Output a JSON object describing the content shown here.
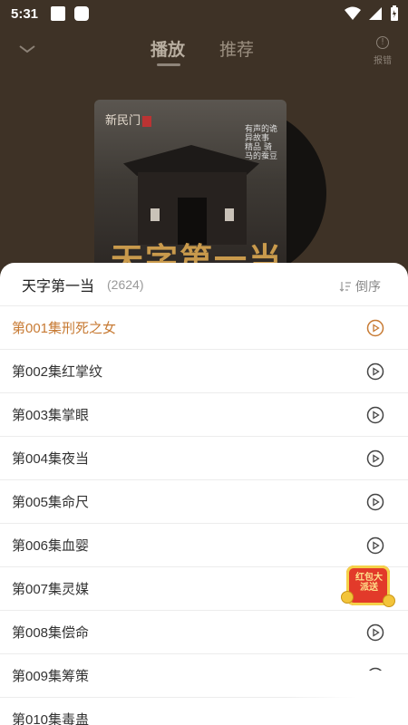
{
  "status_bar": {
    "time": "5:31"
  },
  "nav": {
    "tabs": [
      {
        "label": "播放",
        "active": true
      },
      {
        "label": "推荐",
        "active": false
      }
    ],
    "report_label": "报错",
    "report_icon": "exclamation-circle-icon"
  },
  "cover": {
    "publisher": "新民门",
    "side_text": "有声的诡异故事 精品 骑马的蚕豆",
    "title": "天字第一当"
  },
  "playlist": {
    "title": "天字第一当",
    "count": "(2624)",
    "sort_label": "倒序",
    "episodes": [
      {
        "title": "第001集刑死之女",
        "active": true
      },
      {
        "title": "第002集红掌纹",
        "active": false
      },
      {
        "title": "第003集掌眼",
        "active": false
      },
      {
        "title": "第004集夜当",
        "active": false
      },
      {
        "title": "第005集命尺",
        "active": false
      },
      {
        "title": "第006集血婴",
        "active": false
      },
      {
        "title": "第007集灵媒",
        "active": false
      },
      {
        "title": "第008集偿命",
        "active": false
      },
      {
        "title": "第009集筹策",
        "active": false
      },
      {
        "title": "第010集毒蛊",
        "active": false
      }
    ]
  },
  "promo": {
    "label": "红包大派送"
  },
  "colors": {
    "accent": "#c77a33",
    "background": "#3e3226"
  }
}
